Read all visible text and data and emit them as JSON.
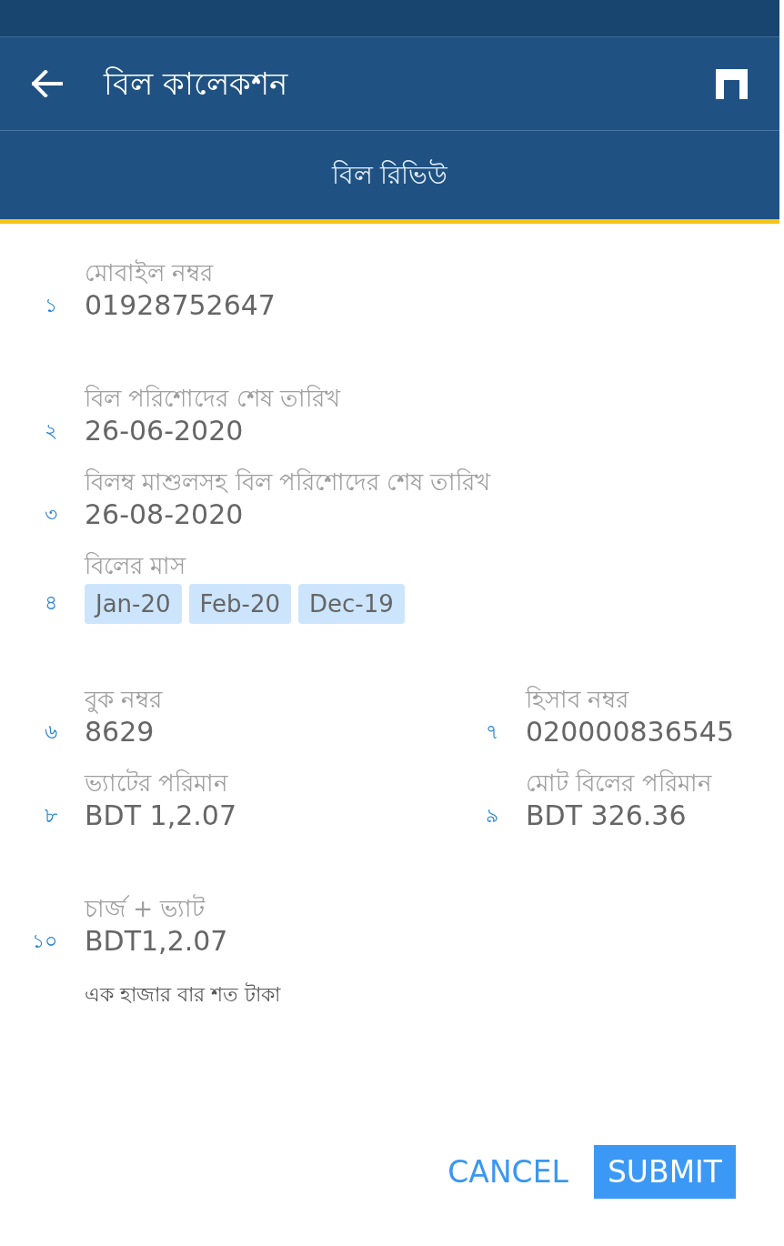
{
  "app_bar": {
    "title": "বিল কালেকশন"
  },
  "tabs": [
    {
      "label": "বিল রিভিউ",
      "selected": true
    }
  ],
  "sections": [
    {
      "rows": [
        {
          "fields": [
            {
              "kind": "text",
              "index": "১",
              "label": "মোবাইল নম্বর",
              "value": "01928752647"
            }
          ]
        }
      ]
    },
    {
      "rows": [
        {
          "fields": [
            {
              "kind": "text",
              "index": "২",
              "label": "বিল পরিশোদের শেষ তারিখ",
              "value": "26-06-2020"
            }
          ]
        },
        {
          "fields": [
            {
              "kind": "text",
              "index": "৩",
              "label": "বিলম্ব মাশুলসহ বিল পরিশোদের শেষ তারিখ",
              "value": "26-08-2020"
            }
          ]
        },
        {
          "fields": [
            {
              "kind": "chips",
              "index": "৪",
              "label": "বিলের মাস",
              "chips": [
                "Jan-20",
                "Feb-20",
                "Dec-19"
              ]
            }
          ]
        }
      ]
    },
    {
      "rows": [
        {
          "fields": [
            {
              "kind": "text",
              "index": "৬",
              "label": "বুক নম্বর",
              "value": "8629"
            },
            {
              "kind": "text",
              "index": "৭",
              "label": "হিসাব নম্বর",
              "value": "020000836545"
            }
          ]
        },
        {
          "fields": [
            {
              "kind": "text",
              "index": "৮",
              "label": "ভ্যাটের পরিমান",
              "value": "BDT 1,2.07"
            },
            {
              "kind": "text",
              "index": "৯",
              "label": "মোট বিলের পরিমান",
              "value": "BDT 326.36"
            }
          ]
        }
      ]
    },
    {
      "rows": [
        {
          "fields": [
            {
              "kind": "text",
              "index": "১০",
              "label": "চার্জ + ভ্যাট",
              "value": "BDT1,2.07",
              "note": "এক হাজার বার শত টাকা"
            }
          ]
        }
      ]
    }
  ],
  "buttons": [
    {
      "kind": "text",
      "label": "CANCEL"
    },
    {
      "kind": "filled",
      "label": "SUBMIT"
    }
  ]
}
